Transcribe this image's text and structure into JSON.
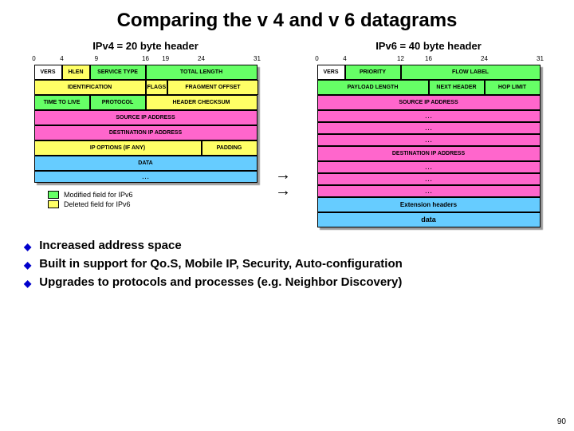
{
  "title": "Comparing the v 4 and v 6 datagrams",
  "v4": {
    "subtitle": "IPv4 = 20 byte header",
    "ticks": [
      "0",
      "4",
      "9",
      "16",
      "19",
      "24",
      "31"
    ],
    "r1": {
      "vers": "VERS",
      "hlen": "HLEN",
      "stype": "SERVICE TYPE",
      "totlen": "TOTAL LENGTH"
    },
    "r2": {
      "ident": "IDENTIFICATION",
      "flags": "FLAGS",
      "frag": "FRAGMENT OFFSET"
    },
    "r3": {
      "ttl": "TIME TO LIVE",
      "proto": "PROTOCOL",
      "chk": "HEADER CHECKSUM"
    },
    "src": "SOURCE IP ADDRESS",
    "dst": "DESTINATION IP ADDRESS",
    "r6": {
      "opt": "IP OPTIONS (IF ANY)",
      "pad": "PADDING"
    },
    "data": "DATA",
    "dots": "…"
  },
  "v6": {
    "subtitle": "IPv6 = 40 byte header",
    "ticks": [
      "0",
      "4",
      "12",
      "16",
      "24",
      "31"
    ],
    "r1": {
      "vers": "VERS",
      "prio": "PRIORITY",
      "flow": "FLOW LABEL"
    },
    "r2": {
      "paylen": "PAYLOAD LENGTH",
      "nexthdr": "NEXT HEADER",
      "hop": "HOP LIMIT"
    },
    "src": "SOURCE IP ADDRESS",
    "dst": "DESTINATION IP ADDRESS",
    "ext": "Extension headers",
    "data": "data",
    "dots": "…"
  },
  "legend": {
    "mod": "Modified field for IPv6",
    "del": "Deleted field for IPv6"
  },
  "bullets": [
    "Increased address space",
    "Built in support for Qo.S, Mobile IP, Security, Auto-configuration",
    "Upgrades to protocols and processes (e.g. Neighbor Discovery)"
  ],
  "slidenum": "90"
}
